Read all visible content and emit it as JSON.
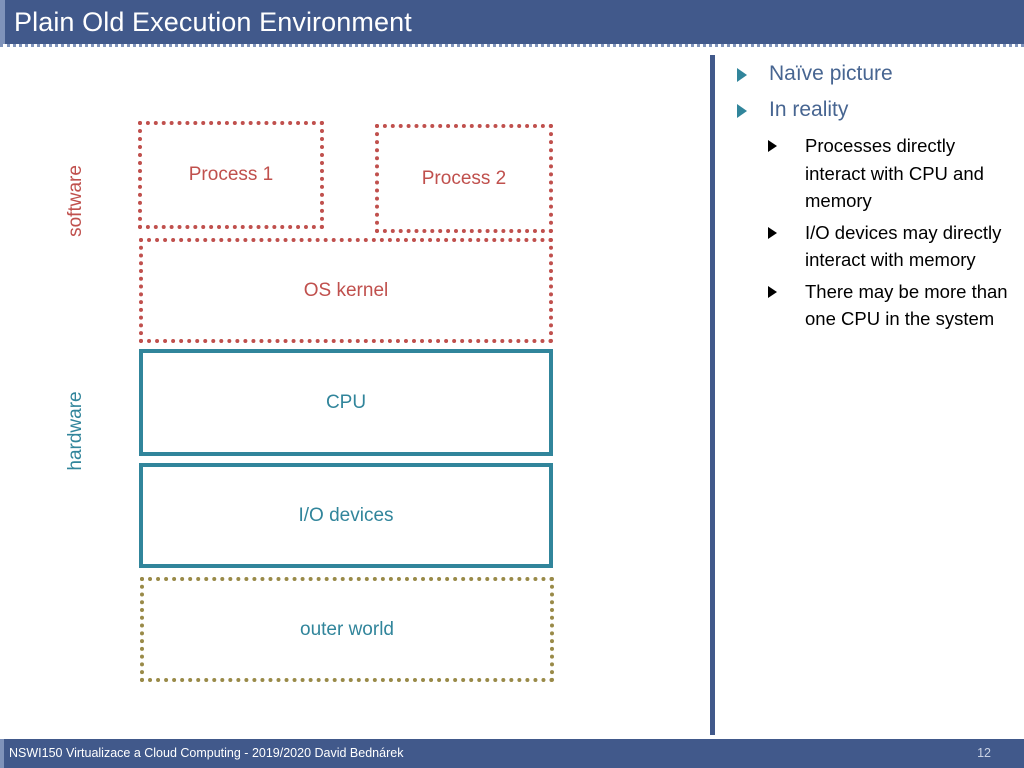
{
  "slide": {
    "title": "Plain Old Execution Environment",
    "title_bar_color": "#41598B",
    "accent_red": "#C0504D",
    "accent_teal": "#31859B",
    "accent_olive": "#998A48"
  },
  "diagram": {
    "side_labels": {
      "software": "software",
      "hardware": "hardware"
    },
    "boxes": [
      {
        "id": "process1",
        "label": "Process 1",
        "style": "red-dotted"
      },
      {
        "id": "process2",
        "label": "Process 2",
        "style": "red-dotted"
      },
      {
        "id": "oskernel",
        "label": "OS kernel",
        "style": "red-dotted"
      },
      {
        "id": "cpu",
        "label": "CPU",
        "style": "teal-solid"
      },
      {
        "id": "io",
        "label": "I/O devices",
        "style": "teal-solid"
      },
      {
        "id": "outer",
        "label": "outer world",
        "style": "olive-dotted"
      }
    ]
  },
  "bullets": {
    "level1": [
      {
        "label": "Naïve picture",
        "children": []
      },
      {
        "label": "In reality",
        "children": [
          "Processes directly interact with CPU and memory",
          "I/O devices may directly interact with memory",
          "There may be more than one CPU in the system"
        ]
      }
    ]
  },
  "footer": {
    "text": "NSWI150 Virtualizace a Cloud Computing - 2019/2020 David Bednárek",
    "page_number": "12"
  }
}
